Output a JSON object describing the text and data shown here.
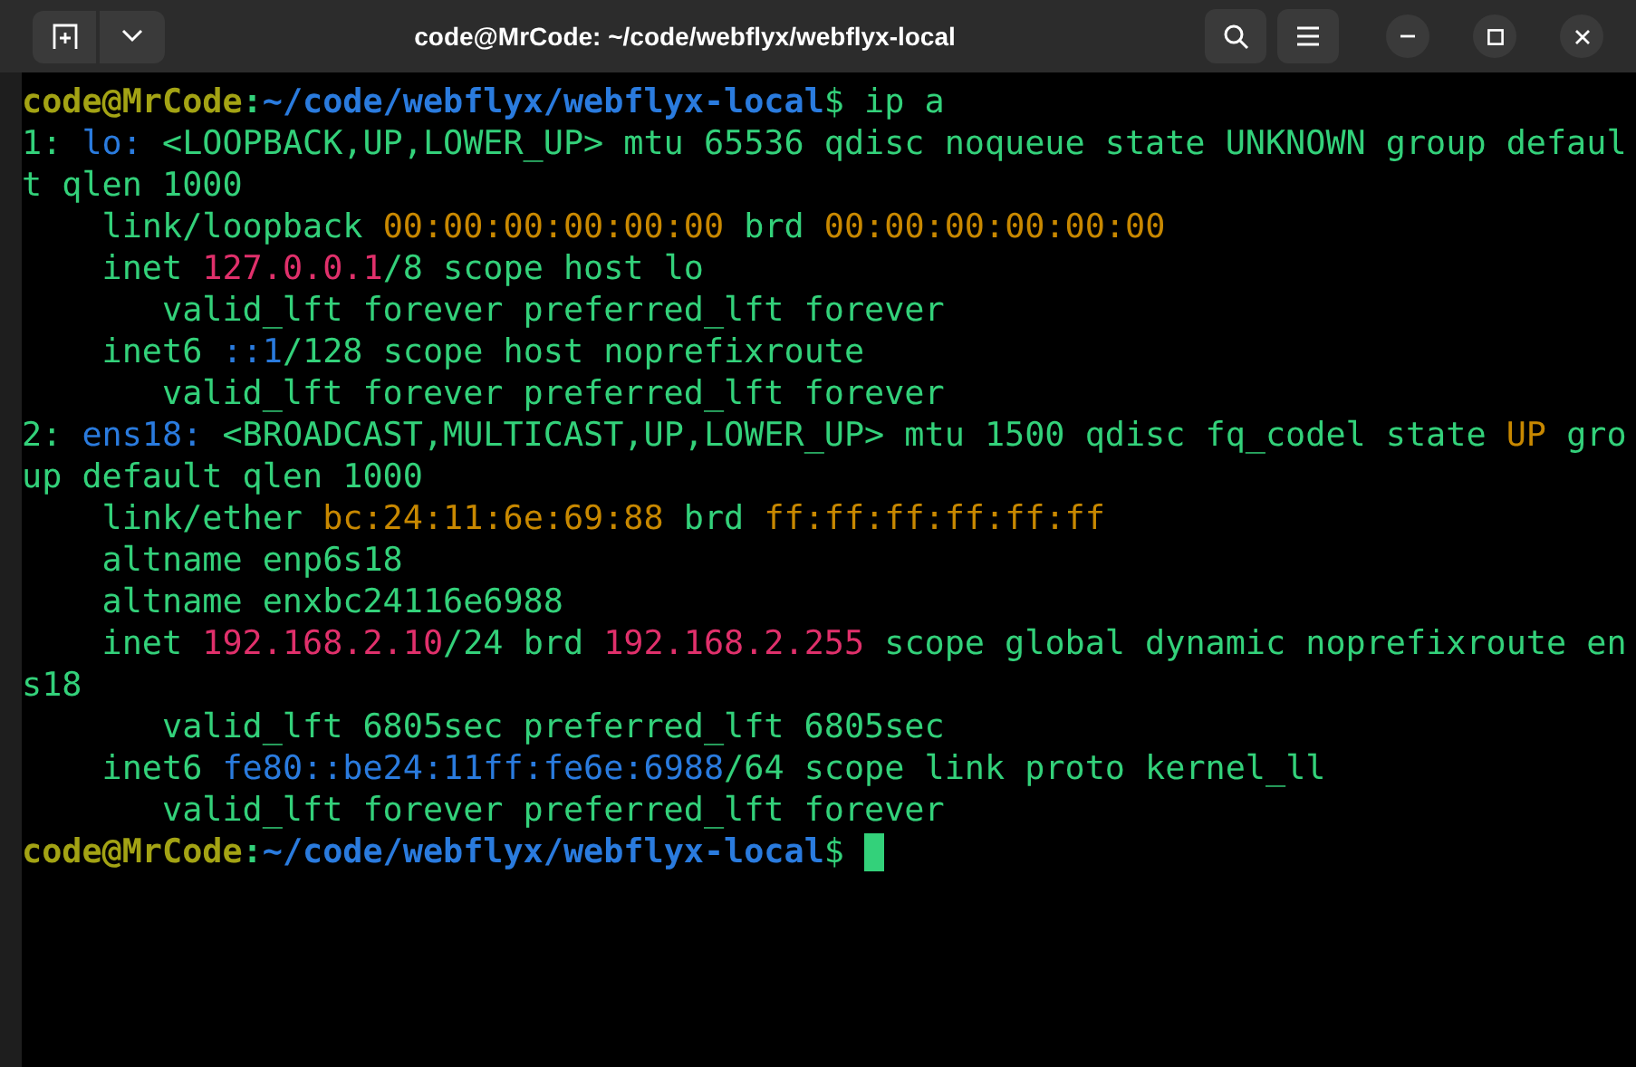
{
  "window": {
    "title": "code@MrCode: ~/code/webflyx/webflyx-local"
  },
  "terminal": {
    "lines": [
      [
        {
          "text": "code@MrCode",
          "color": "#a3a314",
          "bold": true
        },
        {
          "text": ":",
          "color": "#33d17a",
          "bold": true
        },
        {
          "text": "~/code/webflyx/webflyx-local",
          "color": "#2a7bde",
          "bold": true
        },
        {
          "text": "$ ip a",
          "color": "#33d17a",
          "bold": false
        }
      ],
      [
        {
          "text": "1: ",
          "color": "#33d17a",
          "bold": false
        },
        {
          "text": "lo:",
          "color": "#2a7bde",
          "bold": false
        },
        {
          "text": " <LOOPBACK,UP,LOWER_UP> mtu 65536 qdisc noqueue state UNKNOWN group defaul",
          "color": "#33d17a",
          "bold": false
        }
      ],
      [
        {
          "text": "t qlen 1000",
          "color": "#33d17a",
          "bold": false
        }
      ],
      [
        {
          "text": "    link/loopback ",
          "color": "#33d17a",
          "bold": false
        },
        {
          "text": "00:00:00:00:00:00",
          "color": "#c88800",
          "bold": false
        },
        {
          "text": " brd ",
          "color": "#33d17a",
          "bold": false
        },
        {
          "text": "00:00:00:00:00:00",
          "color": "#c88800",
          "bold": false
        }
      ],
      [
        {
          "text": "    inet ",
          "color": "#33d17a",
          "bold": false
        },
        {
          "text": "127.0.0.1",
          "color": "#e0306b",
          "bold": false
        },
        {
          "text": "/8 scope host lo",
          "color": "#33d17a",
          "bold": false
        }
      ],
      [
        {
          "text": "       valid_lft forever preferred_lft forever",
          "color": "#33d17a",
          "bold": false
        }
      ],
      [
        {
          "text": "    inet6 ",
          "color": "#33d17a",
          "bold": false
        },
        {
          "text": "::1",
          "color": "#2a7bde",
          "bold": false
        },
        {
          "text": "/128 scope host noprefixroute",
          "color": "#33d17a",
          "bold": false
        }
      ],
      [
        {
          "text": "       valid_lft forever preferred_lft forever",
          "color": "#33d17a",
          "bold": false
        }
      ],
      [
        {
          "text": "2: ",
          "color": "#33d17a",
          "bold": false
        },
        {
          "text": "ens18:",
          "color": "#2a7bde",
          "bold": false
        },
        {
          "text": " <BROADCAST,MULTICAST,UP,LOWER_UP> mtu 1500 qdisc fq_codel state ",
          "color": "#33d17a",
          "bold": false
        },
        {
          "text": "UP",
          "color": "#c88800",
          "bold": false
        },
        {
          "text": " gro",
          "color": "#33d17a",
          "bold": false
        }
      ],
      [
        {
          "text": "up default qlen 1000",
          "color": "#33d17a",
          "bold": false
        }
      ],
      [
        {
          "text": "    link/ether ",
          "color": "#33d17a",
          "bold": false
        },
        {
          "text": "bc:24:11:6e:69:88",
          "color": "#c88800",
          "bold": false
        },
        {
          "text": " brd ",
          "color": "#33d17a",
          "bold": false
        },
        {
          "text": "ff:ff:ff:ff:ff:ff",
          "color": "#c88800",
          "bold": false
        }
      ],
      [
        {
          "text": "    altname enp6s18",
          "color": "#33d17a",
          "bold": false
        }
      ],
      [
        {
          "text": "    altname enxbc24116e6988",
          "color": "#33d17a",
          "bold": false
        }
      ],
      [
        {
          "text": "    inet ",
          "color": "#33d17a",
          "bold": false
        },
        {
          "text": "192.168.2.10",
          "color": "#e0306b",
          "bold": false
        },
        {
          "text": "/24 brd ",
          "color": "#33d17a",
          "bold": false
        },
        {
          "text": "192.168.2.255",
          "color": "#e0306b",
          "bold": false
        },
        {
          "text": " scope global dynamic noprefixroute en",
          "color": "#33d17a",
          "bold": false
        }
      ],
      [
        {
          "text": "s18",
          "color": "#33d17a",
          "bold": false
        }
      ],
      [
        {
          "text": "       valid_lft 6805sec preferred_lft 6805sec",
          "color": "#33d17a",
          "bold": false
        }
      ],
      [
        {
          "text": "    inet6 ",
          "color": "#33d17a",
          "bold": false
        },
        {
          "text": "fe80::be24:11ff:fe6e:6988",
          "color": "#2a7bde",
          "bold": false
        },
        {
          "text": "/64 scope link proto kernel_ll",
          "color": "#33d17a",
          "bold": false
        }
      ],
      [
        {
          "text": "       valid_lft forever preferred_lft forever",
          "color": "#33d17a",
          "bold": false
        }
      ],
      [
        {
          "text": "code@MrCode",
          "color": "#a3a314",
          "bold": true
        },
        {
          "text": ":",
          "color": "#33d17a",
          "bold": true
        },
        {
          "text": "~/code/webflyx/webflyx-local",
          "color": "#2a7bde",
          "bold": true
        },
        {
          "text": "$ ",
          "color": "#33d17a",
          "bold": false
        }
      ]
    ]
  }
}
